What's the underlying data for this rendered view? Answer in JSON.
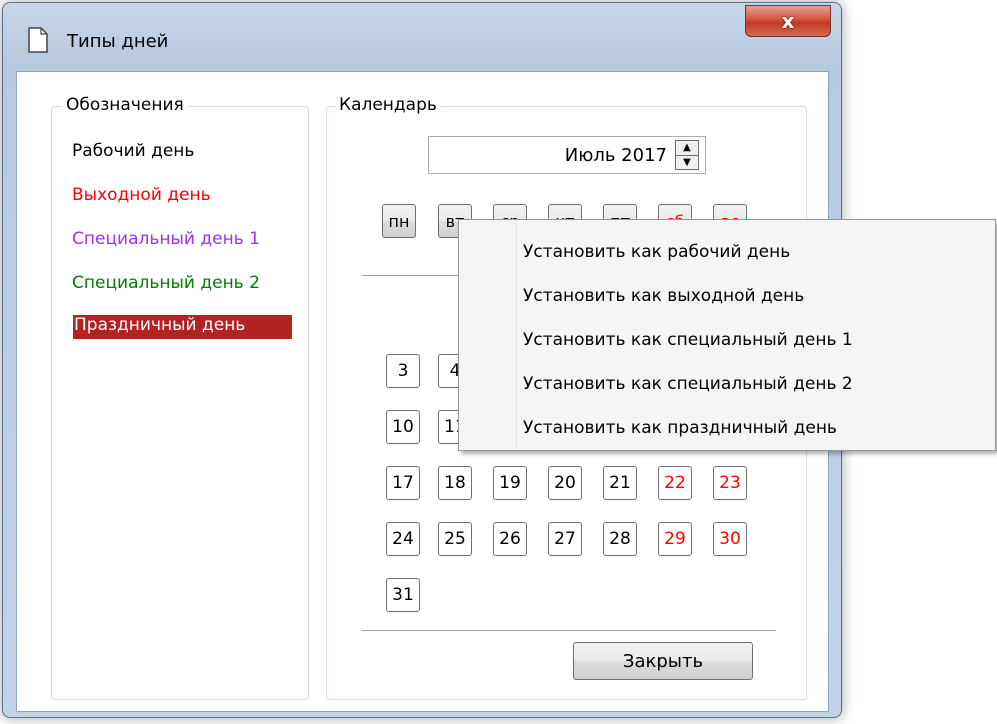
{
  "window": {
    "title": "Типы дней",
    "close_symbol": "x"
  },
  "legend": {
    "group_title": "Обозначения",
    "items": [
      {
        "label": "Рабочий день",
        "color": "#000000"
      },
      {
        "label": "Выходной день",
        "color": "#ff0000"
      },
      {
        "label": "Специальный день 1",
        "color": "#9933ff"
      },
      {
        "label": "Специальный день 2",
        "color": "#008000"
      },
      {
        "label": "Праздничный день",
        "color": "#ffffff",
        "background": "#b22222"
      }
    ]
  },
  "calendar": {
    "group_title": "Календарь",
    "month_value": "Июль 2017",
    "weekdays": [
      "пн",
      "вт",
      "ср",
      "чт",
      "пт",
      "сб",
      "вс"
    ],
    "days": {
      "d3": "3",
      "d4": "4",
      "d10": "10",
      "d11": "11",
      "d17": "17",
      "d18": "18",
      "d19": "19",
      "d20": "20",
      "d21": "21",
      "d22": "22",
      "d23": "23",
      "d24": "24",
      "d25": "25",
      "d26": "26",
      "d27": "27",
      "d28": "28",
      "d29": "29",
      "d30": "30",
      "d31": "31"
    }
  },
  "close_button": "Закрыть",
  "context_menu": {
    "items": [
      "Установить как рабочий день",
      "Установить как выходной день",
      "Установить как специальный день 1",
      "Установить как специальный день 2",
      "Установить как праздничный день"
    ]
  }
}
